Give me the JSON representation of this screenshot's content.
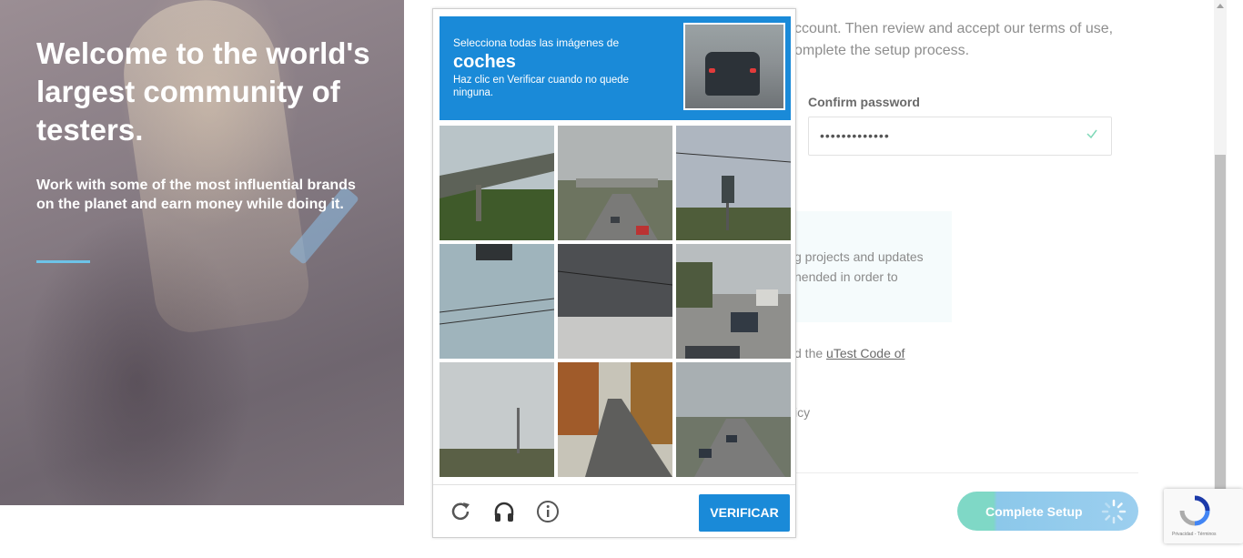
{
  "hero": {
    "headline": "Welcome to the world's largest community of testers.",
    "subheadline": "Work with some of the most influential brands on the planet and earn money while doing it."
  },
  "form": {
    "intro_line1": "ccount. Then review and accept our terms of use,",
    "intro_line2": "omplete the setup process.",
    "confirm_password_label": "Confirm password",
    "confirm_password_value": "•••••••••••••",
    "info_line1": "g projects and updates",
    "info_line2": "nended in order to",
    "code_prefix": "d the ",
    "code_link": "uTest Code of",
    "policy_fragment": "icy",
    "complete_setup": "Complete Setup"
  },
  "captcha": {
    "instruction_top": "Selecciona todas las imágenes de",
    "target_word": "coches",
    "instruction_bottom": "Haz clic en Verificar cuando no quede ninguna.",
    "verify_label": "VERIFICAR",
    "tiles": [
      "overpass-bridge",
      "highway-overpass-with-cars",
      "billboard-trees",
      "traffic-light-wires",
      "sky-wires",
      "street-with-cars",
      "open-field-sky",
      "autumn-road",
      "highway-with-cars"
    ]
  },
  "recaptcha_badge": {
    "caption": "Privacidad - Términos"
  },
  "colors": {
    "captcha_blue": "#1a8ad8",
    "hero_rule": "#6dc3e8",
    "setup_green": "#7fd8c6",
    "setup_blue": "#9ccfef"
  },
  "icons": {
    "reload": "reload-icon",
    "audio": "headphones-icon",
    "info": "info-icon",
    "check": "check-icon",
    "spinner": "spinner-icon"
  }
}
